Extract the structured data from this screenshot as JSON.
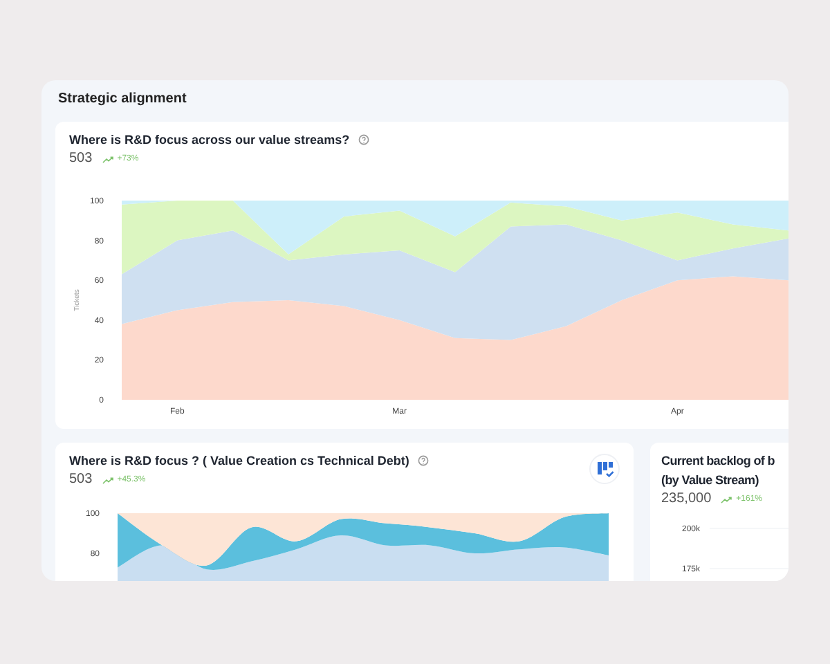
{
  "section": {
    "title": "Strategic alignment"
  },
  "cards": [
    {
      "kind": "area_chart",
      "title": "Where is R&D focus across our value streams?",
      "help_icon": true,
      "badge_icon": false,
      "total": "503",
      "change": "+73%",
      "chart_data": {
        "type": "area",
        "stacked": true,
        "ylabel": "Tickets",
        "categories": [
          null,
          "Feb",
          null,
          null,
          null,
          "Mar",
          null,
          null,
          null,
          null,
          "Apr",
          null,
          null
        ],
        "ylim": [
          0,
          100
        ],
        "yticks": [
          0,
          20,
          40,
          60,
          80,
          100
        ],
        "series": [
          {
            "color": "#fdd9cc",
            "values": [
              38,
              45,
              49,
              50,
              47,
              40,
              31,
              30,
              37,
              50,
              60,
              62,
              60
            ]
          },
          {
            "color": "#cfe0f1",
            "values": [
              25,
              35,
              36,
              20,
              26,
              35,
              33,
              57,
              51,
              30,
              10,
              14,
              21
            ]
          },
          {
            "color": "#dcf6c1",
            "values": [
              35,
              20,
              15,
              3,
              19,
              20,
              18,
              12,
              9,
              10,
              24,
              12,
              4
            ]
          },
          {
            "color": "#cdeffa",
            "values": [
              2,
              0,
              0,
              27,
              8,
              5,
              18,
              1,
              3,
              10,
              6,
              12,
              15
            ]
          }
        ]
      }
    },
    {
      "kind": "area_picture",
      "title": "Where is R&D focus ? ( Value Creation cs Technical Debt)",
      "help_icon": true,
      "badge_icon": true,
      "total": "503",
      "change": "+45.3%",
      "y_tick_labels": [
        "100",
        "80"
      ]
    },
    {
      "kind": "axis_only",
      "title_lines": [
        "Current backlog of b",
        "(by Value Stream)"
      ],
      "help_icon": false,
      "badge_icon": false,
      "total": "235,000",
      "change": "+161%",
      "y_tick_labels": [
        "200k",
        "175k"
      ]
    }
  ]
}
